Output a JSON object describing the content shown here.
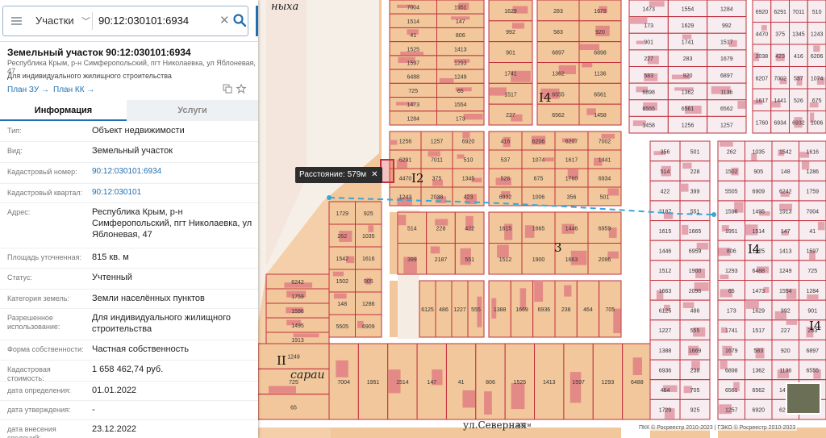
{
  "search": {
    "category": "Участки",
    "query": "90:12:030101:6934"
  },
  "parcel": {
    "title": "Земельный участок 90:12:030101:6934",
    "address_short": "Республика Крым, р-н Симферопольский, пгт Николаевка, ул Яблоневая, 47",
    "purpose_short": "Для индивидуального жилищного строительства",
    "links": [
      "План ЗУ →",
      "План КК →"
    ]
  },
  "tabs": [
    "Информация",
    "Услуги"
  ],
  "fields": [
    {
      "label": "Тип:",
      "value": "Объект недвижимости"
    },
    {
      "label": "Вид:",
      "value": "Земельный участок"
    },
    {
      "label": "Кадастровый номер:",
      "value": "90:12:030101:6934"
    },
    {
      "label": "Кадастровый квартал:",
      "value": "90:12:030101"
    },
    {
      "label": "Адрес:",
      "value": "Республика Крым, р-н Симферопольский, пгт Николаевка, ул Яблоневая, 47"
    },
    {
      "label": "Площадь уточненная:",
      "value": "815 кв. м"
    },
    {
      "label": "Статус:",
      "value": "Учтенный"
    },
    {
      "label": "Категория земель:",
      "value": "Земли населённых пунктов"
    },
    {
      "label": "Разрешенное использование:",
      "value": "Для индивидуального жилищного строительства"
    },
    {
      "label": "Форма собственности:",
      "value": "Частная собственность"
    },
    {
      "label": "Кадастровая стоимость:",
      "value": "1 658 462,74 руб."
    },
    {
      "label": "дата определения:",
      "value": "01.01.2022"
    },
    {
      "label": "дата утверждения:",
      "value": "-"
    },
    {
      "label": "дата внесения сведений:",
      "value": "23.12.2022"
    }
  ],
  "map": {
    "distance_label": "Расстояние: 579м",
    "quarter_labels": [
      "I2",
      "I4",
      "3",
      "I4",
      "I4",
      "II"
    ],
    "street_labels": [
      "сараи",
      "ул.Северная",
      "ныха"
    ],
    "scale": "100 м",
    "copyright": "ПКК © Росреестр 2010-2023 | ГЭКО © Росреестр 2010-2023",
    "colors": {
      "parcel_fill": "#f2c79b",
      "boundary": "#c0303d",
      "road": "#ffffff",
      "measure": "#35a8d8",
      "accent": "#1f6fb2"
    },
    "parcel_numbers": [
      "7004",
      "1951",
      "1514",
      "147",
      "41",
      "806",
      "1525",
      "1413",
      "1597",
      "1293",
      "6488",
      "1249",
      "725",
      "65",
      "1473",
      "1554",
      "1284",
      "173",
      "1629",
      "992",
      "901",
      "1741",
      "1517",
      "227",
      "283",
      "1679",
      "583",
      "920",
      "6897",
      "6898",
      "1362",
      "1136",
      "6555",
      "6561",
      "6562",
      "1458",
      "1256",
      "1257",
      "6920",
      "6291",
      "7011",
      "510",
      "4470",
      "375",
      "1345",
      "1243",
      "2038",
      "423",
      "416",
      "6206",
      "6207",
      "7002",
      "537",
      "1074",
      "1617",
      "1441",
      "526",
      "675",
      "1760",
      "6934",
      "6932",
      "1006",
      "356",
      "501",
      "514",
      "228",
      "422",
      "399",
      "2187",
      "551",
      "1615",
      "1665",
      "1446",
      "6959",
      "1512",
      "1900",
      "1663",
      "2096",
      "6125",
      "486",
      "1227",
      "555",
      "1388",
      "1669",
      "6936",
      "238",
      "464",
      "705",
      "1729",
      "925",
      "262",
      "1035",
      "1542",
      "1616",
      "1502",
      "905",
      "148",
      "1286",
      "5505",
      "6909",
      "6242",
      "1759",
      "1596",
      "1495",
      "1913"
    ]
  }
}
